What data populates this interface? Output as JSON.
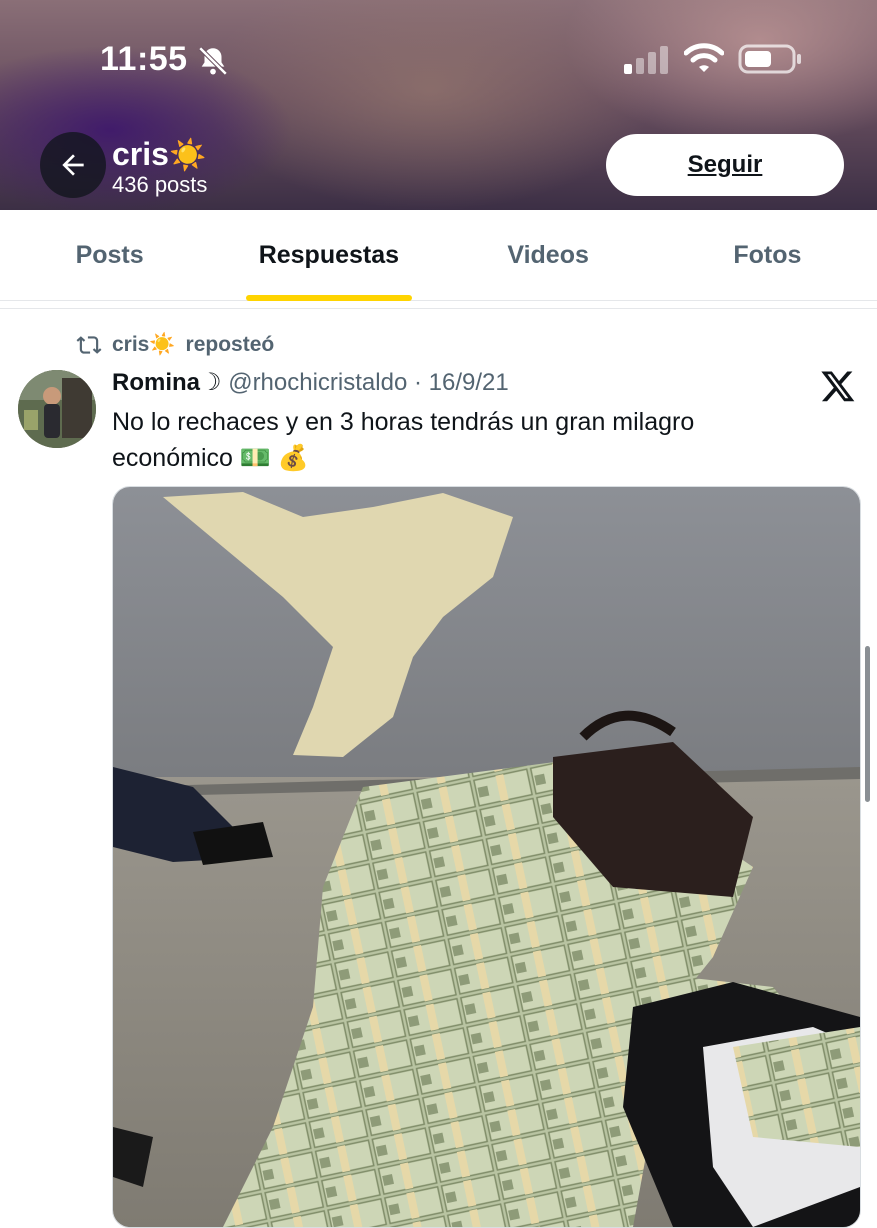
{
  "status_bar": {
    "time": "11:55"
  },
  "profile": {
    "name": "cris",
    "name_emoji": "☀️",
    "posts_count": "436 posts",
    "follow_label": "Seguir"
  },
  "tabs": [
    {
      "label": "Posts",
      "active": false
    },
    {
      "label": "Respuestas",
      "active": true
    },
    {
      "label": "Videos",
      "active": false
    },
    {
      "label": "Fotos",
      "active": false
    }
  ],
  "repost": {
    "user": "cris",
    "user_emoji": "☀️",
    "label": "reposteó"
  },
  "tweet": {
    "author": "Romina☽",
    "handle": "@rhochicristaldo",
    "separator": "·",
    "date": "16/9/21",
    "text": "No lo rechaces y en 3 horas tendrás un gran milagro económico 💵 💰"
  },
  "icons": {
    "back": "arrow-left-icon",
    "bell_off": "bell-slash-icon",
    "signal": "cellular-signal-icon",
    "wifi": "wifi-icon",
    "battery": "battery-icon",
    "repost": "repost-icon",
    "x_logo": "x-logo-icon"
  },
  "colors": {
    "accent_tab": "#ffd400",
    "text_primary": "#0f1419",
    "text_secondary": "#536471"
  }
}
